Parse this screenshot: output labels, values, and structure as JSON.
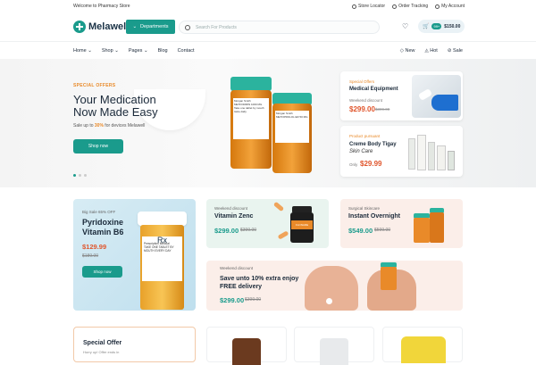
{
  "topbar": {
    "welcome": "Welcome to Pharmacy Store",
    "store_locator": "Store Locator",
    "order_tracking": "Order Tracking",
    "account": "My Account"
  },
  "header": {
    "brand": "Melawell",
    "departments": "Departments",
    "search_placeholder": "Search For Products",
    "cart_badge": "99+",
    "cart_total": "$150.00"
  },
  "nav": {
    "left": [
      "Home",
      "Shop",
      "Pages",
      "Blog",
      "Contact"
    ],
    "right": [
      "New",
      "Hot",
      "Sale"
    ]
  },
  "hero": {
    "kicker": "SPECIAL OFFERS",
    "title": "Your Medication Now Made Easy",
    "sub_prefix": "Sale up to ",
    "sub_pct": "30%",
    "sub_suffix": " for devices Melawell",
    "button": "Shop now",
    "bottle1_brand": "amazon pharmacy",
    "bottle1_label": "Morgan Smith\nMETFORMIN 1000 MG\nTake one tablet by mouth twice daily",
    "bottle2_brand": "amazon pharmacy",
    "bottle2_label": "Morgan Smith\nMETOPROLOL ER 50 MG"
  },
  "side_cards": [
    {
      "kicker": "Special Offers",
      "name": "Medical Equipment",
      "weekend": "Weekend discount",
      "price": "$299.00",
      "old": "$399.00"
    },
    {
      "kicker": "Product pursuant",
      "name": "Creme Body Tigay",
      "sub": "Skin Care",
      "only": "Only",
      "price": "$29.99"
    }
  ],
  "tiles": {
    "big": {
      "kicker": "Big Sale 65% OFF",
      "name": "Pyridoxine Vitamin B6",
      "price": "$129.99",
      "old": "$189.00",
      "button": "Shop now",
      "rx": "Rx",
      "label": "Prescription Medical\nTAKE ONE TABLET BY\nMOUTH EVERY DAY"
    },
    "zinc": {
      "kicker": "Weekend discount",
      "name": "Vitamin Zenc",
      "price": "$299.00",
      "old": "$399.00",
      "jar": "FLONARE"
    },
    "skincare": {
      "kicker": "Surgical Skincare",
      "name": "Instant Overnight",
      "price": "$549.00",
      "old": "$599.00"
    },
    "delivery": {
      "kicker": "Weekend discount",
      "name": "Save unto 10% extra enjoy FREE delivery",
      "price": "$299.00",
      "old": "$399.00"
    }
  },
  "bottom": {
    "special": "Special Offer",
    "special_sub": "Hurry up! Offer ends in"
  },
  "colors": {
    "accent": "#1a9b8c",
    "price": "#e0562d",
    "orange": "#e98a29"
  }
}
